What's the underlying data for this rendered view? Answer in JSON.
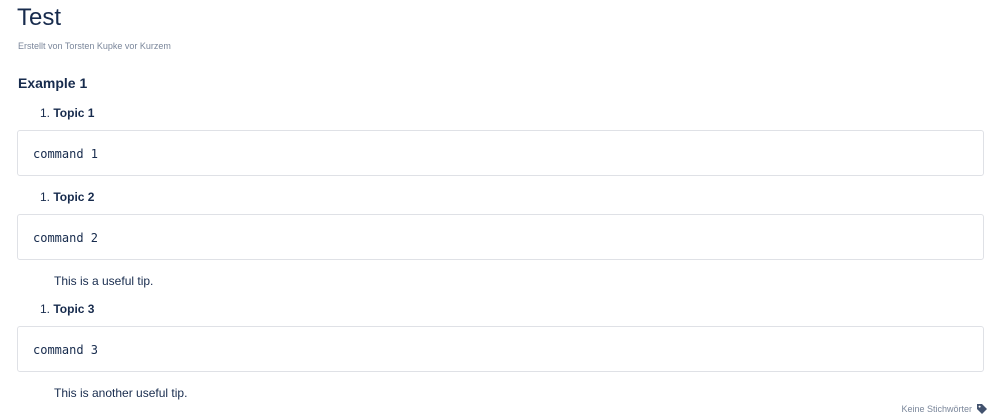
{
  "page": {
    "title": "Test",
    "byline": "Erstellt von Torsten Kupke vor Kurzem"
  },
  "section": {
    "heading": "Example 1"
  },
  "topics": [
    {
      "number": "1.",
      "label": "Topic 1",
      "command": "command 1",
      "tip": ""
    },
    {
      "number": "1.",
      "label": "Topic 2",
      "command": "command 2",
      "tip": "This is a useful tip."
    },
    {
      "number": "1.",
      "label": "Topic 3",
      "command": "command 3",
      "tip": "This is another useful tip."
    }
  ],
  "footer": {
    "labels_text": "Keine Stichwörter",
    "labels_icon": "tag-icon"
  }
}
